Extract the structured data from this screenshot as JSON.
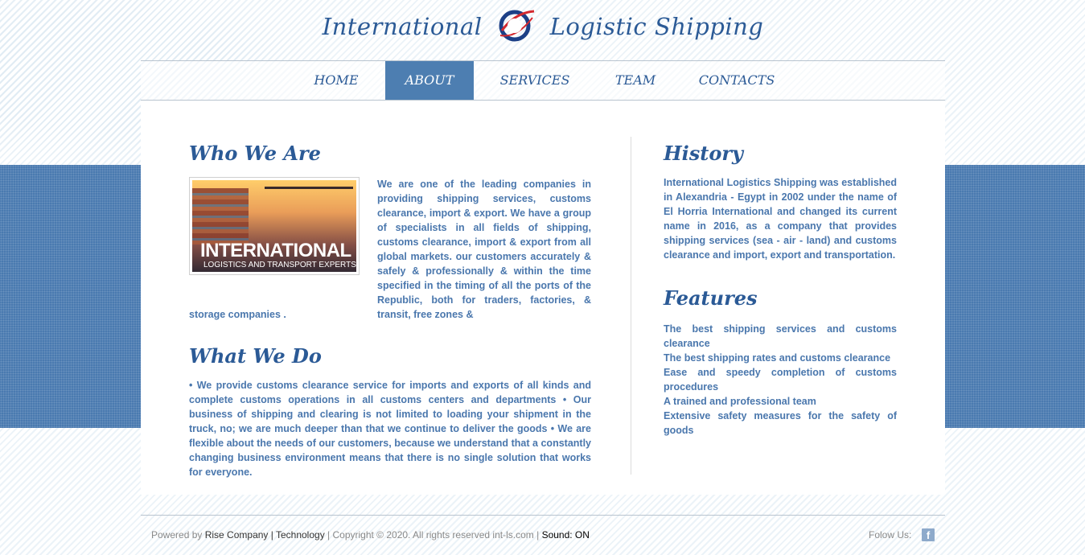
{
  "header": {
    "brand_left": "International",
    "brand_right": "Logistic Shipping",
    "emblem_icon": "globe-logo-icon"
  },
  "nav": {
    "items": [
      {
        "label": "HOME"
      },
      {
        "label": "ABOUT"
      },
      {
        "label": "SERVICES"
      },
      {
        "label": "TEAM"
      },
      {
        "label": "CONTACTS"
      }
    ],
    "active": "ABOUT"
  },
  "who": {
    "title": "Who We Are",
    "image_caption_main": "INTERNATIONAL",
    "image_caption_sub": "LOGISTICS AND TRANSPORT EXPERTS",
    "text_side": "We are one of the leading companies in providing shipping services, customs clearance, import & export. We have a group of specialists in all fields of shipping, customs clearance, import & export from all global markets. our customers accurately & safely & professionally & within the time specified in the timing of all the ports of the Republic, both for traders, factories, & transit, free zones &",
    "text_bottom": "storage companies ."
  },
  "what": {
    "title": "What We Do",
    "text": "• We provide customs clearance service for imports and exports of all kinds and complete customs operations in all customs centers and departments • Our business of shipping and clearing is not limited to loading your shipment in the truck, no; we are much deeper than that we continue to deliver the goods • We are flexible about the needs of our customers, because we understand that a constantly changing business environment means that there is no single solution that works for everyone."
  },
  "history": {
    "title": "History",
    "text": "International Logistics Shipping was established in Alexandria - Egypt in 2002 under the name of El Horria International and changed its current name in 2016, as a company that provides shipping services (sea - air - land) and customs clearance and import, export and transportation."
  },
  "features": {
    "title": "Features",
    "items": [
      "The best shipping services and customs clearance",
      "The best shipping rates and customs clearance",
      "Ease and speedy completion of customs procedures",
      "A trained and professional team",
      "Extensive safety measures for the safety of goods"
    ]
  },
  "footer": {
    "powered_by": "Powered by",
    "company_link": "Rise Company | Technology",
    "copyright": " | Copyright © 2020. All rights reserved int-ls.com  | ",
    "sound": "Sound: ON",
    "follow": "Folow Us:",
    "facebook_icon": "facebook-icon"
  },
  "colors": {
    "brand_blue": "#2b5a96",
    "text_blue": "#4a77ad",
    "nav_active": "#4d7eb1",
    "band_blue": "#4a7ab0"
  }
}
